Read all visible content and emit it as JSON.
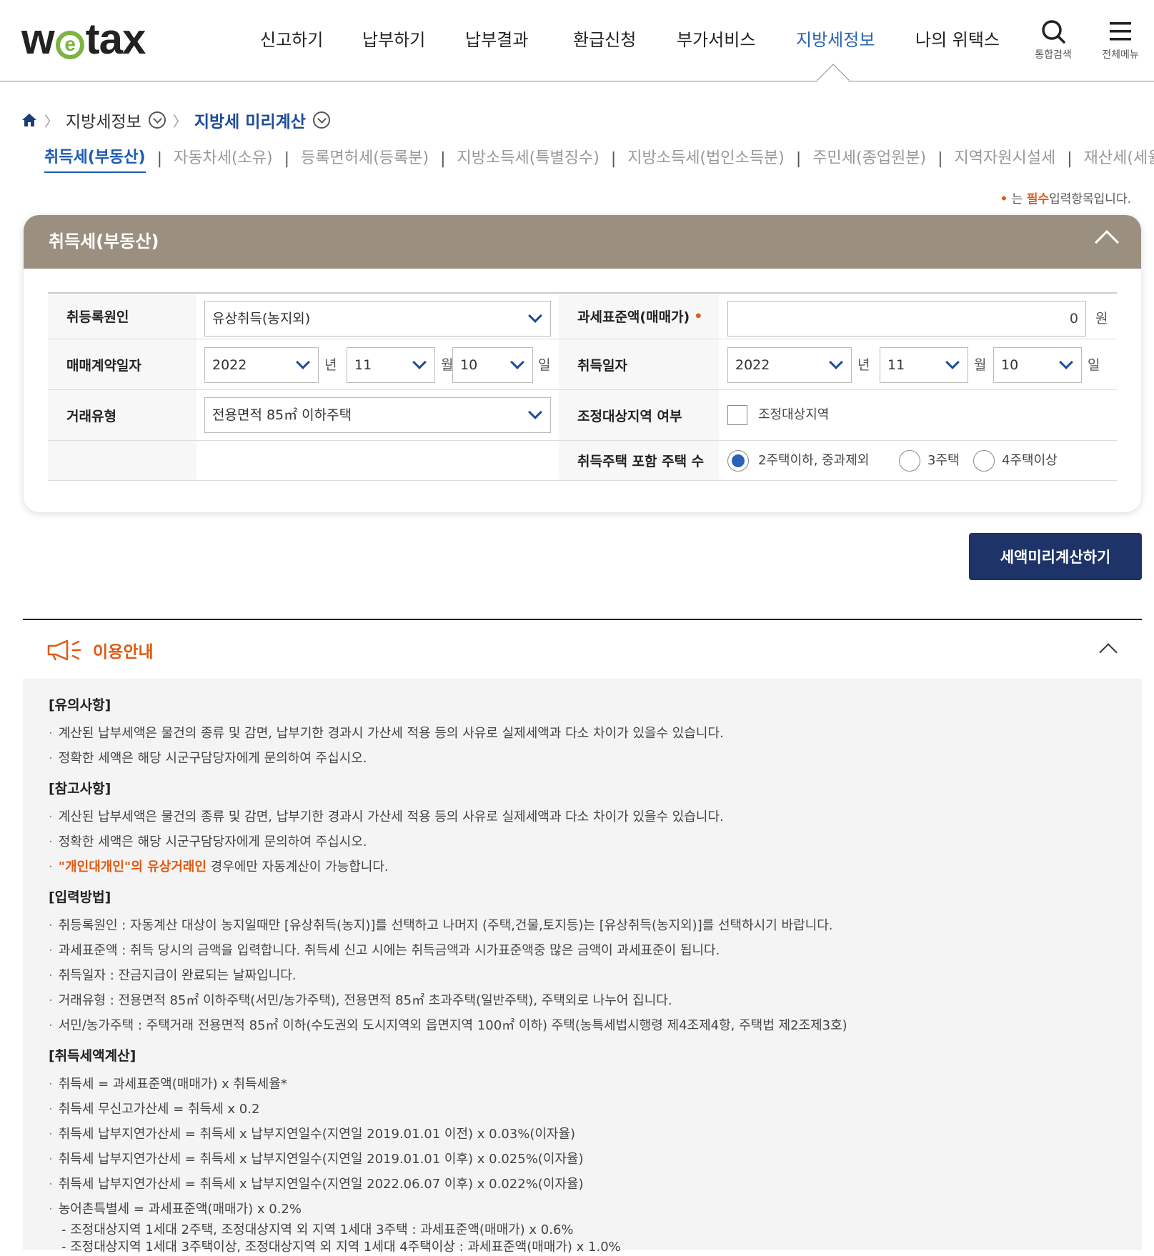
{
  "header": {
    "logo": "wetax",
    "nav": [
      "신고하기",
      "납부하기",
      "납부결과",
      "환급신청",
      "부가서비스",
      "지방세정보",
      "나의 위택스"
    ],
    "active_nav": "지방세정보",
    "search_label": "통합검색",
    "menu_label": "전체메뉴"
  },
  "breadcrumb": {
    "level1": "지방세정보",
    "level2": "지방세 미리계산"
  },
  "subtabs": [
    "취득세(부동산)",
    "자동차세(소유)",
    "등록면허세(등록분)",
    "지방소득세(특별징수)",
    "지방소득세(법인소득분)",
    "주민세(종업원분)",
    "지역자원시설세",
    "재산세(세율특례)"
  ],
  "required_note": {
    "bullet": "•",
    "pre": "는 ",
    "req": "필수",
    "post": "입력항목입니다."
  },
  "panel": {
    "title": "취득세(부동산)",
    "cause_label": "취등록원인",
    "cause_value": "유상취득(농지외)",
    "tax_base_label": "과세표준액(매매가)",
    "tax_base_value": "0",
    "won": "원",
    "contract_date_label": "매매계약일자",
    "contract_date": {
      "year": "2022",
      "month": "11",
      "day": "10"
    },
    "acq_date_label": "취득일자",
    "acq_date": {
      "year": "2022",
      "month": "11",
      "day": "10"
    },
    "unit_year": "년",
    "unit_month": "월",
    "unit_day": "일",
    "deal_type_label": "거래유형",
    "deal_type_value": "전용면적 85㎡ 이하주택",
    "adjust_label": "조정대상지역 여부",
    "adjust_option": "조정대상지역",
    "house_count_label": "취득주택 포함 주택 수",
    "house_options": [
      "2주택이하, 중과제외",
      "3주택",
      "4주택이상"
    ],
    "house_selected": "2주택이하, 중과제외"
  },
  "calc_button": "세액미리계산하기",
  "guide": {
    "title": "이용안내",
    "sections": [
      {
        "title": "[유의사항]",
        "items": [
          "계산된 납부세액은 물건의 종류 및 감면, 납부기한 경과시 가산세 적용 등의 사유로 실제세액과 다소 차이가 있을수 있습니다.",
          "정확한 세액은 해당 시군구담당자에게 문의하여 주십시오."
        ]
      },
      {
        "title": "[참고사항]",
        "items": [
          "계산된 납부세액은 물건의 종류 및 감면, 납부기한 경과시 가산세 적용 등의 사유로 실제세액과 다소 차이가 있을수 있습니다.",
          "정확한 세액은 해당 시군구담당자에게 문의하여 주십시오."
        ],
        "highlight_item": {
          "hl": "\"개인대개인\"의 유상거래인",
          "rest": " 경우에만 자동계산이 가능합니다."
        }
      },
      {
        "title": "[입력방법]",
        "items": [
          "취등록원인 : 자동계산 대상이 농지일때만 [유상취득(농지)]를 선택하고 나머지 (주택,건물,토지등)는 [유상취득(농지외)]를 선택하시기 바랍니다.",
          "과세표준액 : 취득 당시의 금액을 입력합니다. 취득세 신고 시에는 취득금액과 시가표준액중 많은 금액이 과세표준이 됩니다.",
          "취득일자 : 잔금지급이 완료되는 날짜입니다.",
          "거래유형 : 전용면적 85㎡ 이하주택(서민/농가주택), 전용면적 85㎡ 초과주택(일반주택), 주택외로 나누어 집니다.",
          "서민/농가주택 : 주택거래 전용면적 85㎡ 이하(수도권외 도시지역외 읍면지역 100㎡ 이하) 주택(농특세법시행령 제4조제4항, 주택법 제2조제3호)"
        ]
      },
      {
        "title": "[취득세액계산]",
        "items": [
          "취득세 = 과세표준액(매매가) x 취득세율*",
          "취득세 무신고가산세 = 취득세 x 0.2",
          "취득세 납부지연가산세 = 취득세 x 납부지연일수(지연일 2019.01.01 이전) x 0.03%(이자율)",
          "취득세 납부지연가산세 = 취득세 x 납부지연일수(지연일 2019.01.01 이후) x 0.025%(이자율)",
          "취득세 납부지연가산세 = 취득세 x 납부지연일수(지연일 2022.06.07 이후) x 0.022%(이자율)",
          "농어촌특별세 = 과세표준액(매매가) x 0.2%"
        ],
        "subitems": [
          "- 조정대상지역 1세대 2주택, 조정대상지역 외 지역 1세대 3주택 : 과세표준액(매매가) x 0.6%",
          "- 조정대상지역 1세대 3주택이상, 조정대상지역 외 지역 1세대 4주택이상 : 과세표준액(매매가) x 1.0%"
        ]
      }
    ]
  }
}
